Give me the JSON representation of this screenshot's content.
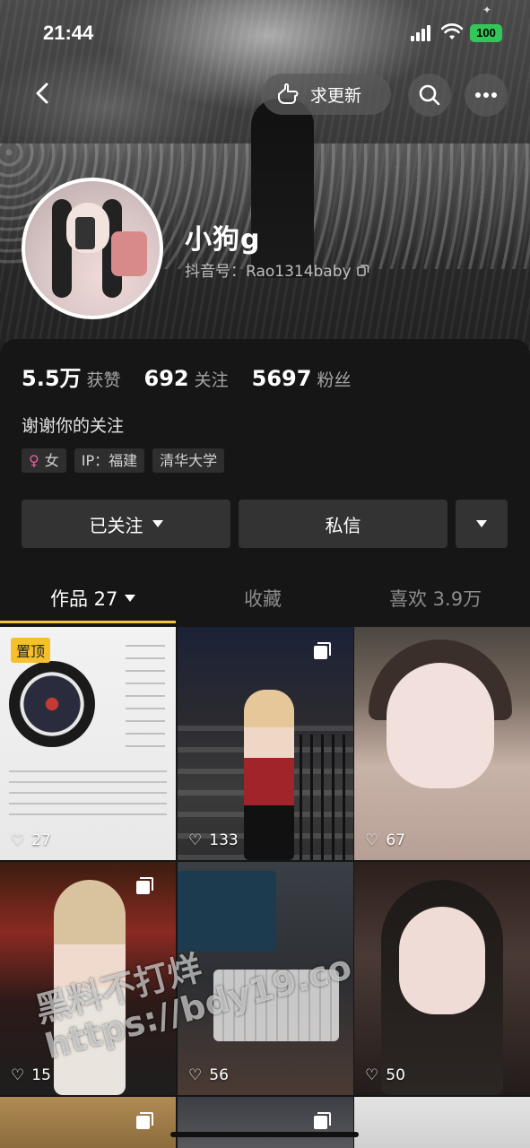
{
  "status_bar": {
    "time": "21:44",
    "battery": "100"
  },
  "nav": {
    "update_label": "求更新"
  },
  "profile": {
    "name": "小狗g",
    "douyin_id": "抖音号：Rao1314baby",
    "stats": [
      {
        "num": "5.5万",
        "label": "获赞"
      },
      {
        "num": "692",
        "label": "关注"
      },
      {
        "num": "5697",
        "label": "粉丝"
      }
    ],
    "bio": "谢谢你的关注",
    "tags": {
      "gender": "女",
      "ip": "IP：福建",
      "school": "清华大学"
    }
  },
  "actions": {
    "followed": "已关注",
    "message": "私信"
  },
  "tabs": {
    "works": "作品 27",
    "collect": "收藏",
    "likes": "喜欢 3.9万"
  },
  "videos": [
    {
      "likes": "27",
      "pinned": "置顶"
    },
    {
      "likes": "133"
    },
    {
      "likes": "67"
    },
    {
      "likes": "15"
    },
    {
      "likes": "56"
    },
    {
      "likes": "50"
    }
  ],
  "watermark": {
    "line1": "黑料不打烊",
    "line2": "https://bdy19.co"
  },
  "colors": {
    "accent": "#f7c33b",
    "panel": "#161616",
    "button": "#333333"
  }
}
